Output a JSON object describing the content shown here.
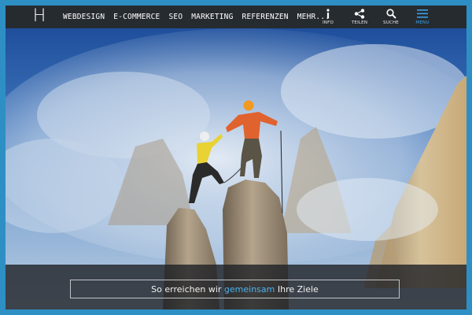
{
  "header": {
    "logo": "H",
    "nav": [
      {
        "label": "WEBDESIGN"
      },
      {
        "label": "E-COMMERCE"
      },
      {
        "label": "SEO"
      },
      {
        "label": "MARKETING"
      },
      {
        "label": "REFERENZEN"
      },
      {
        "label": "MEHR..."
      }
    ],
    "tools": [
      {
        "icon": "info-icon",
        "label": "INFO"
      },
      {
        "icon": "share-icon",
        "label": "TEILEN"
      },
      {
        "icon": "search-icon",
        "label": "SUCHE"
      },
      {
        "icon": "menu-icon",
        "label": "MENU"
      }
    ]
  },
  "hero": {
    "image": "two-climbers-on-rock-pinnacles",
    "caption_before": "So erreichen wir ",
    "caption_accent": "gemeinsam",
    "caption_after": " Ihre Ziele"
  },
  "colors": {
    "frame": "#2e8fc4",
    "header_bg": "#262b30",
    "accent": "#4cb3ef"
  }
}
